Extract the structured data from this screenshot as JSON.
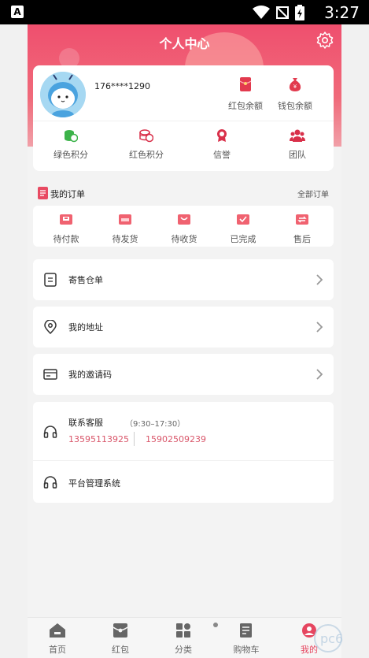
{
  "status_bar": {
    "time": "3:27",
    "a_label": "A"
  },
  "header": {
    "title": "个人中心"
  },
  "profile": {
    "phone": "176****1290",
    "wallets": [
      {
        "label": "红包余额",
        "icon": "red-envelope-icon"
      },
      {
        "label": "钱包余额",
        "icon": "money-bag-icon"
      }
    ],
    "points": [
      {
        "label": "绿色积分",
        "icon": "green-coins-icon",
        "color": "#3cb34a"
      },
      {
        "label": "红色积分",
        "icon": "red-coins-icon",
        "color": "#d9304a"
      },
      {
        "label": "信誉",
        "icon": "medal-icon",
        "color": "#d9304a"
      },
      {
        "label": "团队",
        "icon": "team-icon",
        "color": "#d9304a"
      }
    ]
  },
  "orders": {
    "title": "我的订单",
    "all_label": "全部订单",
    "items": [
      {
        "label": "待付款",
        "icon": "wallet-pay-icon"
      },
      {
        "label": "待发货",
        "icon": "box-ship-icon"
      },
      {
        "label": "待收货",
        "icon": "package-receive-icon"
      },
      {
        "label": "已完成",
        "icon": "check-done-icon"
      },
      {
        "label": "售后",
        "icon": "after-sale-icon"
      }
    ]
  },
  "menu": [
    {
      "label": "寄售仓单",
      "icon": "document-icon"
    },
    {
      "label": "我的地址",
      "icon": "location-pin-icon"
    },
    {
      "label": "我的邀请码",
      "icon": "card-icon"
    }
  ],
  "service": {
    "label": "联系客服",
    "hours": "（9:30–17:30）",
    "phone1": "13595113925",
    "phone2": "15902509239",
    "platform_label": "平台管理系统"
  },
  "tabbar": [
    {
      "label": "首页",
      "icon": "home-icon",
      "active": false
    },
    {
      "label": "红包",
      "icon": "red-envelope-tab-icon",
      "active": false
    },
    {
      "label": "分类",
      "icon": "category-grid-icon",
      "active": false
    },
    {
      "label": "购物车",
      "icon": "cart-icon",
      "active": false
    },
    {
      "label": "我的",
      "icon": "profile-tab-icon",
      "active": true
    }
  ],
  "colors": {
    "accent": "#e64660",
    "header_top": "#ef4f6e",
    "phone_link": "#d9566a"
  },
  "watermark": "pc6"
}
